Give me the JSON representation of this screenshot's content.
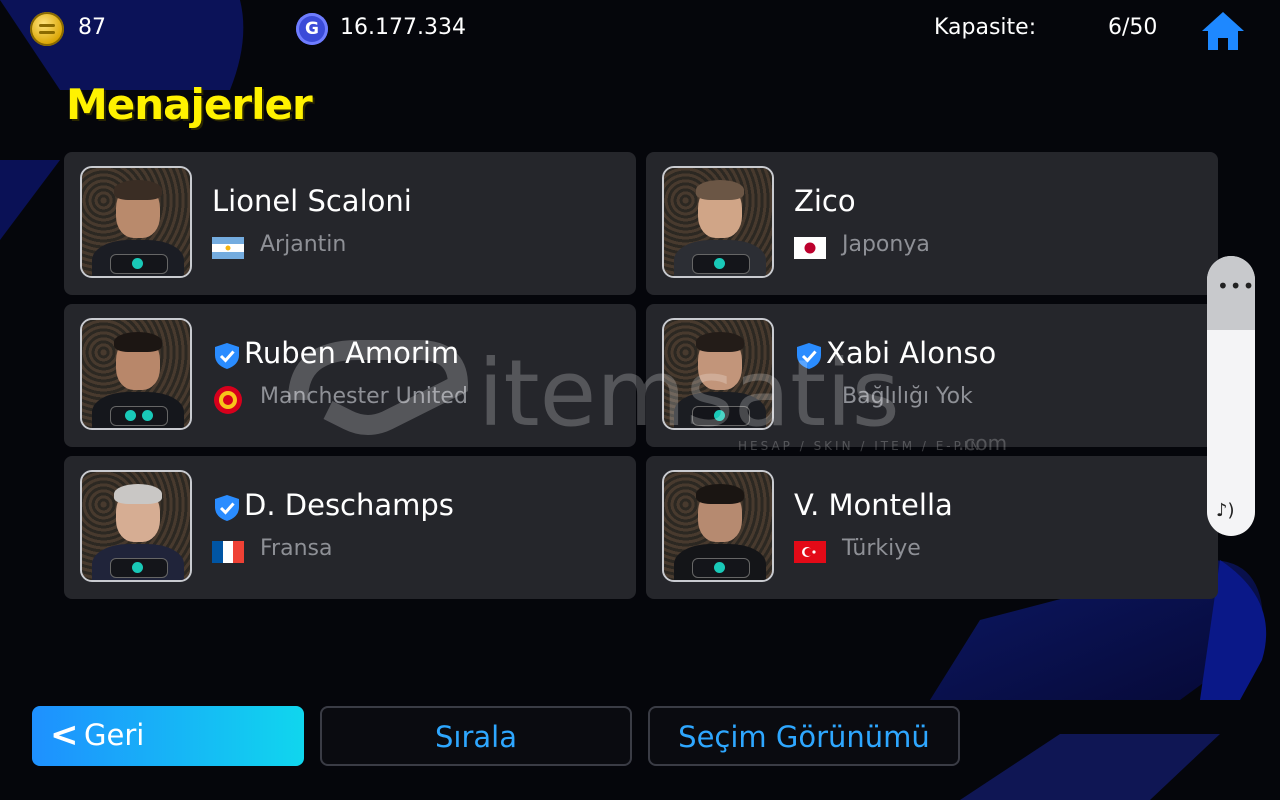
{
  "topbar": {
    "coins": "87",
    "gp": "16.177.334",
    "capacity_label": "Kapasite:",
    "capacity_value": "6/50"
  },
  "title": "Menajerler",
  "managers": [
    {
      "name": "Lionel Scaloni",
      "sub": "Arjantin",
      "verified": false,
      "flag": "argentina"
    },
    {
      "name": "Zico",
      "sub": "Japonya",
      "verified": false,
      "flag": "japan"
    },
    {
      "name": "Ruben Amorim",
      "sub": "Manchester United",
      "verified": true,
      "flag": "man-utd-crest"
    },
    {
      "name": "Xabi Alonso",
      "sub": "Bağlılığı Yok",
      "verified": true,
      "flag": "none"
    },
    {
      "name": "D. Deschamps",
      "sub": "Fransa",
      "verified": true,
      "flag": "france"
    },
    {
      "name": "V. Montella",
      "sub": "Türkiye",
      "verified": false,
      "flag": "turkey"
    }
  ],
  "buttons": {
    "back": "Geri",
    "sort": "Sırala",
    "view": "Seçim Görünümü"
  },
  "side_panel": {
    "dots": "•••",
    "icon": "music-note-sound-icon"
  },
  "watermark": {
    "brand": "itemsatis",
    "tagline": "HESAP / SKIN / ITEM / E-PIN",
    "suffix": ".com"
  },
  "colors": {
    "title_yellow": "#fff200",
    "accent_blue": "#2ea7ff",
    "card_bg": "#25262b",
    "home_icon": "#1e88ff"
  }
}
